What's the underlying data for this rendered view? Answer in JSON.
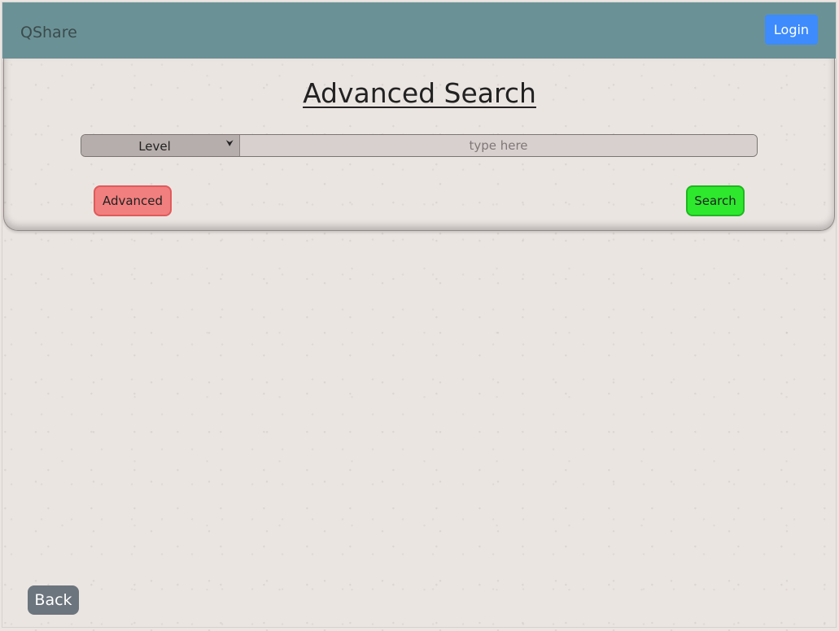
{
  "navbar": {
    "brand": "QShare",
    "login_label": "Login"
  },
  "search_panel": {
    "title": "Advanced Search",
    "filter_select": {
      "selected": "Level"
    },
    "query_input": {
      "value": "",
      "placeholder": "type here"
    },
    "advanced_label": "Advanced",
    "search_label": "Search"
  },
  "footer": {
    "back_label": "Back"
  },
  "colors": {
    "navbar": "#6a9296",
    "login_button": "#3d8bfd",
    "advanced_button": "#f17f7f",
    "search_button": "#2ee82e",
    "back_button": "#6c757d"
  },
  "icons": {
    "select_indicator": "chevron-down-icon"
  }
}
